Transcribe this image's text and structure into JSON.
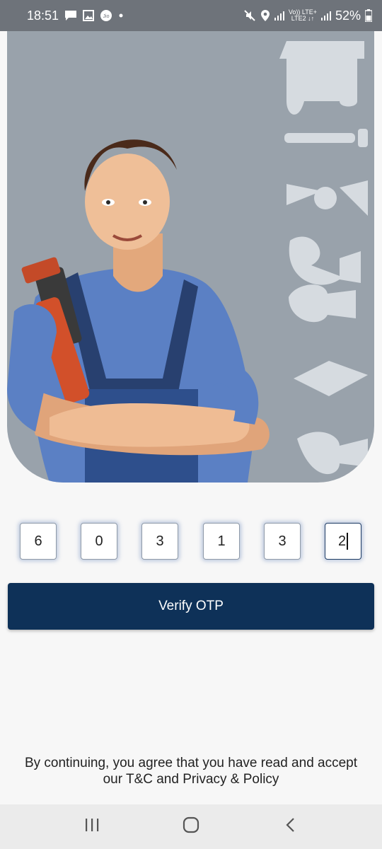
{
  "status_bar": {
    "time": "18:51",
    "volte_top": "Vo)) LTE+",
    "volte_bottom": "LTE2 ↓↑",
    "battery": "52%",
    "icons": [
      "message-icon",
      "gallery-icon",
      "jio-icon",
      "dot-icon",
      "mute-icon",
      "location-icon",
      "signal-icon",
      "battery-icon"
    ]
  },
  "hero": {
    "illustration": "plumber-with-wrench-and-tools"
  },
  "otp": {
    "digits": [
      "6",
      "0",
      "3",
      "1",
      "3",
      "2"
    ],
    "active_index": 5
  },
  "verify_button": {
    "label": "Verify OTP"
  },
  "terms": {
    "line1": "By continuing, you agree that you have read and accept",
    "line2": "our T&C and Privacy & Policy"
  },
  "nav": {
    "icons": [
      "recent-apps-icon",
      "home-icon",
      "back-icon"
    ]
  },
  "colors": {
    "hero_bg": "#99a2ab",
    "button_bg": "#0e3158",
    "status_bar_bg": "#6e737a"
  }
}
